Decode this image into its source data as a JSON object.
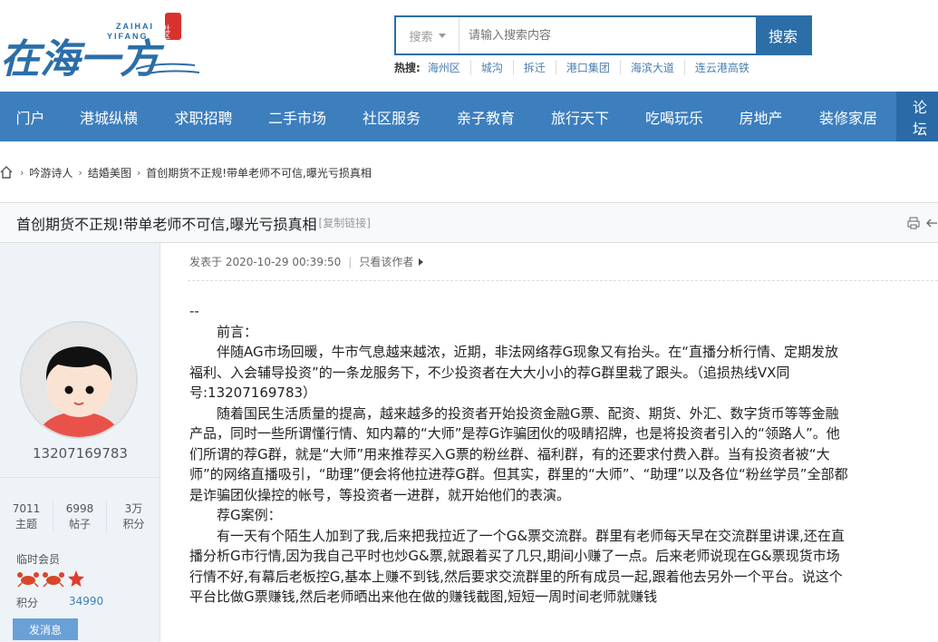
{
  "site": {
    "logo_main": "在海一方",
    "logo_sub_1": "ZAIHAI",
    "logo_sub_2": "YIFANG",
    "logo_seal": "社区"
  },
  "search": {
    "select_label": "搜索",
    "placeholder": "请输入搜索内容",
    "button": "搜索",
    "hot_label": "热搜:",
    "hot_terms": [
      "海州区",
      "城沟",
      "拆迁",
      "港口集团",
      "海滨大道",
      "连云港高铁"
    ]
  },
  "nav": {
    "items": [
      "门户",
      "港城纵横",
      "求职招聘",
      "二手市场",
      "社区服务",
      "亲子教育",
      "旅行天下",
      "吃喝玩乐",
      "房地产",
      "装修家居",
      "论坛"
    ]
  },
  "breadcrumb": {
    "items": [
      "吟游诗人",
      "结婚美图",
      "首创期货不正规!带单老师不可信,曝光亏损真相"
    ]
  },
  "thread": {
    "title": "首创期货不正规!带单老师不可信,曝光亏损真相",
    "copy_link": "[复制链接]"
  },
  "user": {
    "name": "13207169783",
    "stats": [
      {
        "value": "7011",
        "label": "主题"
      },
      {
        "value": "6998",
        "label": "帖子"
      },
      {
        "value": "3万",
        "label": "积分"
      }
    ],
    "group": "临时会员",
    "score_label": "积分",
    "score_value": "34990",
    "send_message": "发消息"
  },
  "post": {
    "posted_at": "发表于 2020-10-29 00:39:50",
    "only_author": "只看该作者",
    "paragraphs": [
      "--",
      "前言：",
      "伴随AG市场回暖，牛市气息越来越浓，近期，非法网络荐G现象又有抬头。在“直播分析行情、定期发放福利、入会辅导投资”的一条龙服务下，不少投资者在大大小小的荐G群里栽了跟头。（追损热线VX同号:13207169783）",
      "随着国民生活质量的提高，越来越多的投资者开始投资金融G票、配资、期货、外汇、数字货币等等金融产品，同时一些所谓懂行情、知内幕的“大师”是荐G诈骗团伙的吸睛招牌，也是将投资者引入的“领路人”。他们所谓的荐G群，就是“大师”用来推荐买入G票的粉丝群、福利群，有的还要求付费入群。当有投资者被“大师”的网络直播吸引，“助理”便会将他拉进荐G群。但其实，群里的“大师”、“助理”以及各位“粉丝学员”全部都是诈骗团伙操控的帐号，等投资者一进群，就开始他们的表演。",
      "荐G案例：",
      "有一天有个陌生人加到了我,后来把我拉近了一个G&票交流群。群里有老师每天早在交流群里讲课,还在直播分析G市行情,因为我自己平时也炒G&票,就跟着买了几只,期间小赚了一点。后来老师说现在G&票现货市场行情不好,有幕后老板控G,基本上赚不到钱,然后要求交流群里的所有成员一起,跟着他去另外一个平台。说这个平台比做G票赚钱,然后老师晒出来他在做的赚钱截图,短短一周时间老师就赚钱"
    ]
  }
}
